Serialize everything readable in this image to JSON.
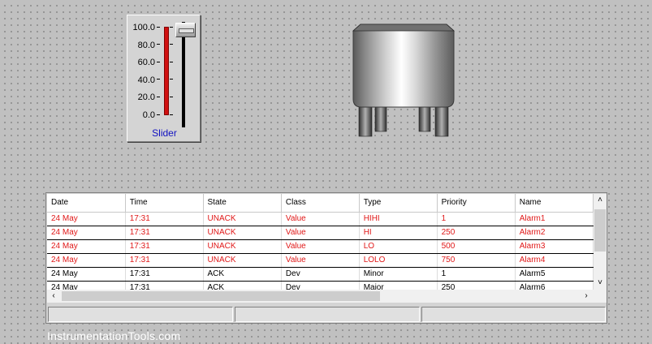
{
  "slider": {
    "caption": "Slider",
    "scale": [
      "100.0",
      "80.0",
      "60.0",
      "40.0",
      "20.0",
      "0.0"
    ],
    "value": 100.0,
    "colors": {
      "bar": "#d01010",
      "caption": "#1010c0"
    }
  },
  "tank": {
    "icon": "storage-tank-icon"
  },
  "alarm_table": {
    "columns": [
      "Date",
      "Time",
      "State",
      "Class",
      "Type",
      "Priority",
      "Name"
    ],
    "rows": [
      {
        "date": "24 May",
        "time": "17:31",
        "state": "UNACK",
        "class": "Value",
        "type": "HIHI",
        "priority": "1",
        "name": "Alarm1"
      },
      {
        "date": "24 May",
        "time": "17:31",
        "state": "UNACK",
        "class": "Value",
        "type": "HI",
        "priority": "250",
        "name": "Alarm2"
      },
      {
        "date": "24 May",
        "time": "17:31",
        "state": "UNACK",
        "class": "Value",
        "type": "LO",
        "priority": "500",
        "name": "Alarm3"
      },
      {
        "date": "24 May",
        "time": "17:31",
        "state": "UNACK",
        "class": "Value",
        "type": "LOLO",
        "priority": "750",
        "name": "Alarm4"
      },
      {
        "date": "24 May",
        "time": "17:31",
        "state": "ACK",
        "class": "Dev",
        "type": "Minor",
        "priority": "1",
        "name": "Alarm5"
      },
      {
        "date": "24 May",
        "time": "17:31",
        "state": "ACK",
        "class": "Dev",
        "type": "Major",
        "priority": "250",
        "name": "Alarm6"
      }
    ],
    "colors": {
      "unack": "#e01818",
      "ack": "#000000"
    }
  },
  "watermark": "InstrumentationTools.com"
}
